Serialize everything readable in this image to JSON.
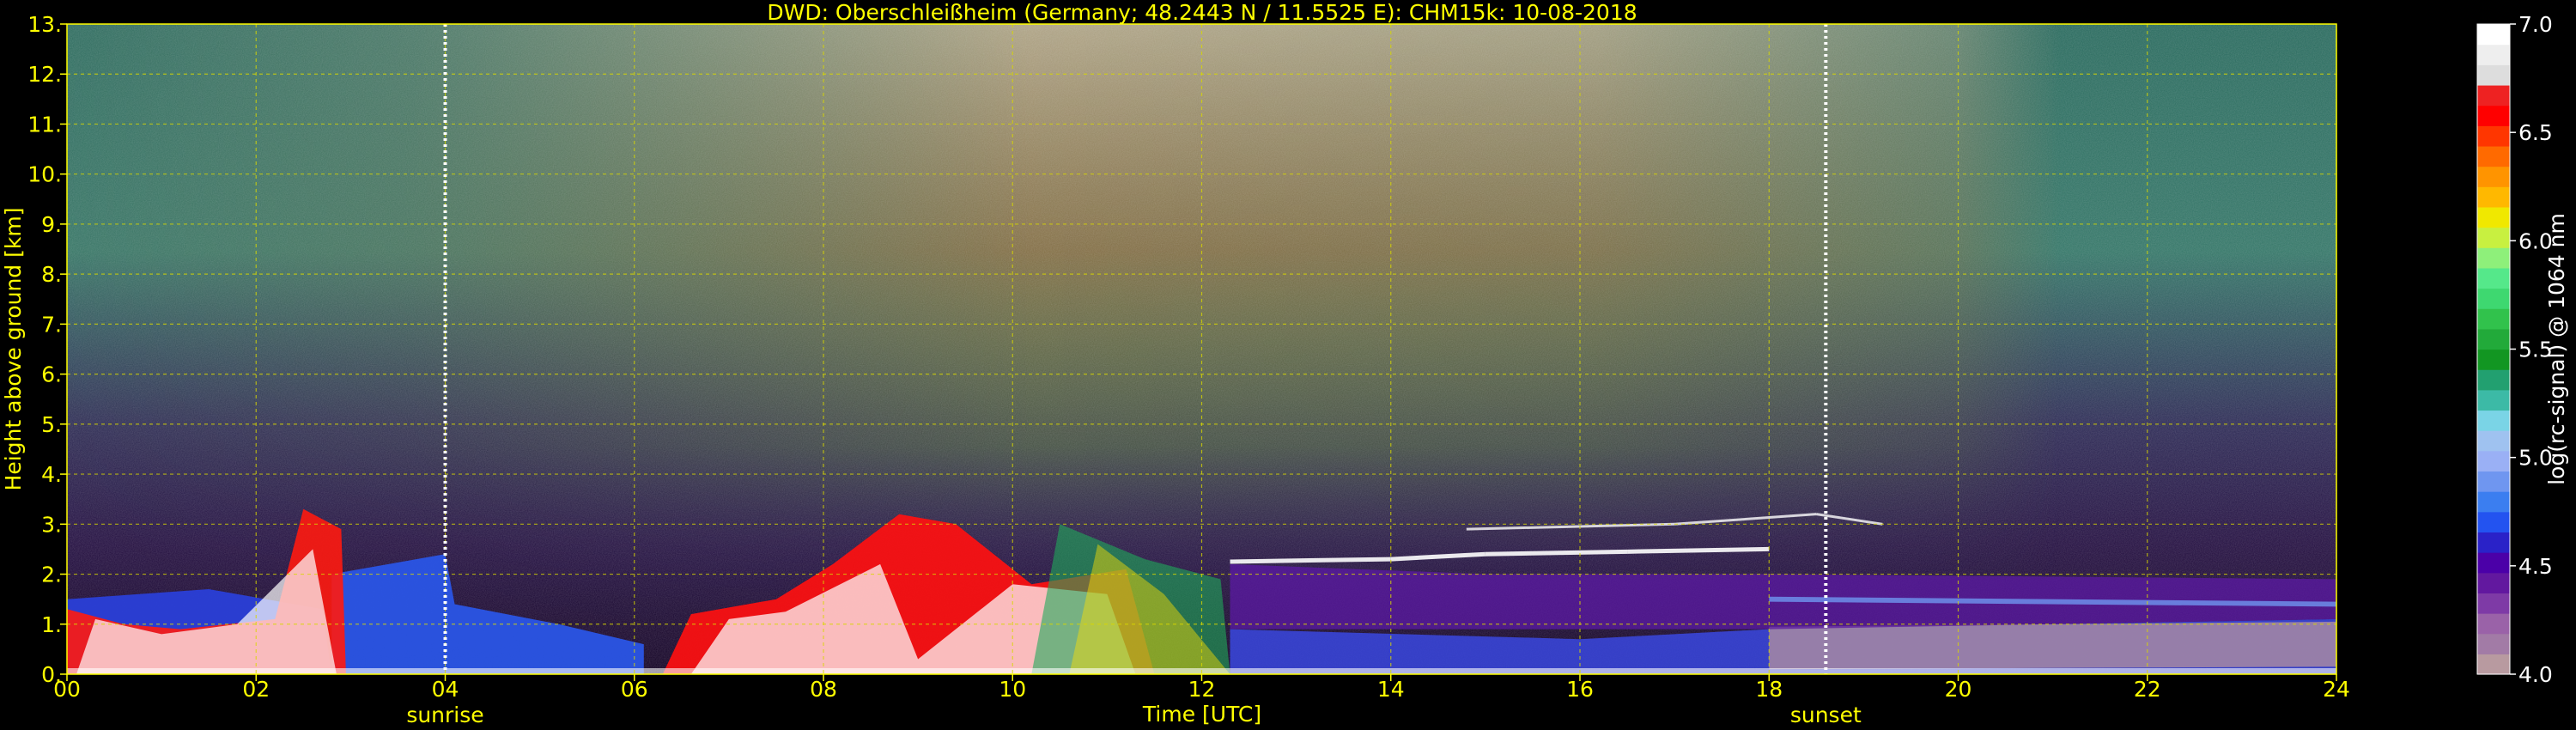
{
  "chart_data": {
    "type": "heatmap",
    "title": "DWD: Oberschleißheim (Germany; 48.2443 N / 11.5525 E):    CHM15k: 10-08-2018",
    "xlabel": "Time [UTC]",
    "ylabel": "Height above ground [km]",
    "colorbar_label": "log(rc-signal) @ 1064 nm",
    "xlim": [
      0,
      24
    ],
    "ylim": [
      0,
      13
    ],
    "x_ticks": [
      0,
      2,
      4,
      6,
      8,
      10,
      12,
      14,
      16,
      18,
      20,
      22,
      24
    ],
    "x_tick_labels": [
      "00",
      "02",
      "04",
      "06",
      "08",
      "10",
      "12",
      "14",
      "16",
      "18",
      "20",
      "22",
      "24"
    ],
    "y_ticks": [
      0,
      1,
      2,
      3,
      4,
      5,
      6,
      7,
      8,
      9,
      10,
      11,
      12,
      13
    ],
    "y_tick_labels": [
      "0.",
      "1.",
      "2.",
      "3.",
      "4.",
      "5.",
      "6.",
      "7.",
      "8.",
      "9.",
      "10.",
      "11.",
      "12.",
      "13."
    ],
    "colorbar_range": [
      4.0,
      7.0
    ],
    "colorbar_ticks": [
      "4.0",
      "4.5",
      "5.0",
      "5.5",
      "6.0",
      "6.5",
      "7.0"
    ],
    "colorbar_colors": [
      "#b89aa0",
      "#a27ba6",
      "#9a62a8",
      "#7e3aa6",
      "#62189f",
      "#4b00a8",
      "#2a22c8",
      "#2353f0",
      "#3b7ef0",
      "#6f96f0",
      "#9ab0f5",
      "#9fc2f0",
      "#7ad4e6",
      "#3cbaa6",
      "#22a070",
      "#129622",
      "#22aa3a",
      "#31c24c",
      "#3ed870",
      "#55e88a",
      "#8ef07a",
      "#c8f040",
      "#f0e800",
      "#ffb800",
      "#ff9400",
      "#ff6a00",
      "#ff3600",
      "#ff0000",
      "#ee2222",
      "#dddddd",
      "#eeeeee",
      "#ffffff"
    ],
    "grid": true,
    "markers": [
      {
        "label": "sunrise",
        "x": 4.0
      },
      {
        "label": "sunset",
        "x": 18.6
      }
    ],
    "features": {
      "cloud_top_layer_km": [
        {
          "x": 12.3,
          "y": 2.25
        },
        {
          "x": 14.0,
          "y": 2.3
        },
        {
          "x": 15.0,
          "y": 2.4
        },
        {
          "x": 16.5,
          "y": 2.45
        },
        {
          "x": 18.0,
          "y": 2.5
        }
      ],
      "elevated_layer_km": [
        {
          "x": 14.8,
          "y": 2.9
        },
        {
          "x": 17.0,
          "y": 3.0
        },
        {
          "x": 18.5,
          "y": 3.2
        },
        {
          "x": 19.2,
          "y": 3.0
        }
      ]
    }
  }
}
